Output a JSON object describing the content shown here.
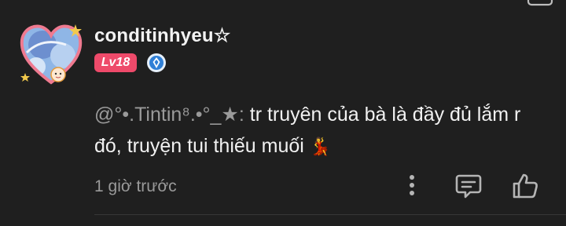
{
  "comment": {
    "username": "conditinhyeu☆",
    "level_badge": "Lv18",
    "mention": "@°•.Tintin⁸.•°_★:",
    "text": " tr truyên của bà là đầy đủ lắm r đó, truyện tui thiếu muối",
    "emoji": "💃",
    "timestamp": "1 giờ trước"
  },
  "icons": {
    "more": "more-vertical-icon",
    "reply": "comment-reply-icon",
    "like": "thumbs-up-icon",
    "verify": "verified-badge-icon"
  },
  "colors": {
    "background": "#1f1f1f",
    "level_badge": "#ee4a6a",
    "muted": "#9a9a9a",
    "verify_blue": "#2f7fd6"
  }
}
